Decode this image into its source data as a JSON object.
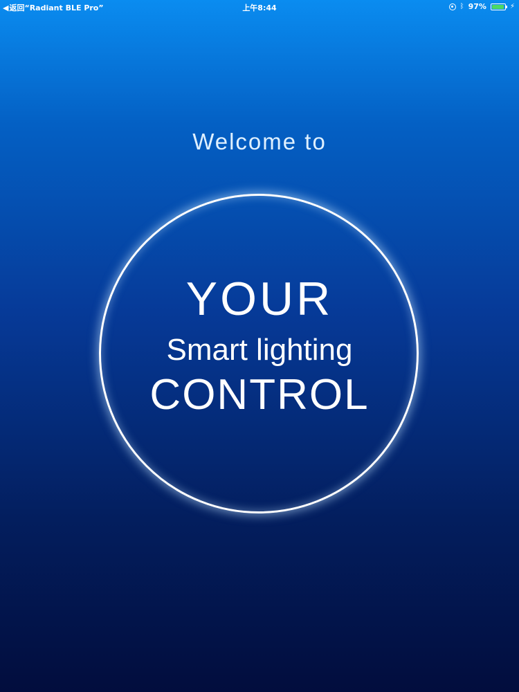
{
  "status_bar": {
    "back_label": "返回“Radiant BLE Pro”",
    "time": "上午8:44",
    "battery_percent": "97%",
    "battery_level": 0.97,
    "icons": [
      "orientation-lock-icon",
      "bluetooth-icon",
      "battery-icon",
      "charging-icon"
    ]
  },
  "welcome": {
    "greeting": "Welcome to",
    "line1": "YOUR",
    "line2": "Smart lighting",
    "line3": "CONTROL"
  },
  "colors": {
    "gradient_top": "#0a8cf0",
    "gradient_bottom": "#020d3d",
    "ring": "#ffffff",
    "battery_fill": "#4cd964"
  }
}
